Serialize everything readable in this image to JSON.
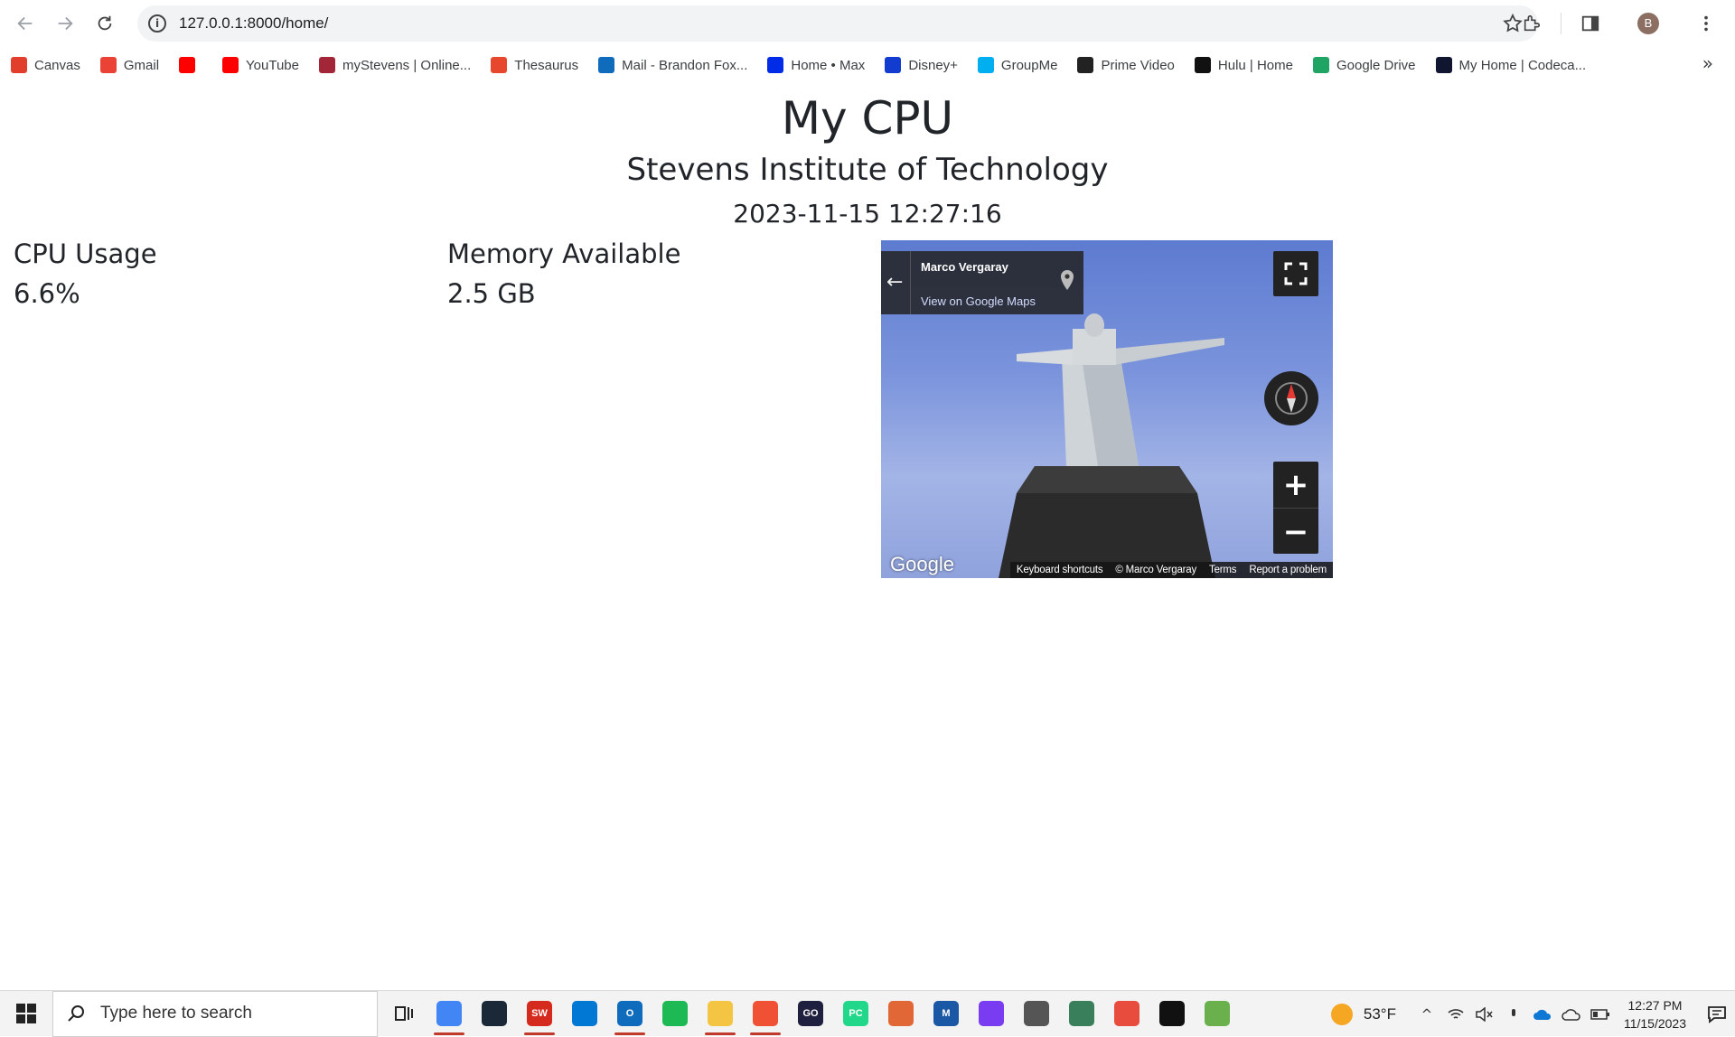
{
  "browser": {
    "url": "127.0.0.1:8000/home/",
    "profile_initial": "B",
    "bookmarks": [
      {
        "label": "Canvas",
        "icon": "canvas-icon",
        "color": "#e13f2b"
      },
      {
        "label": "Gmail",
        "icon": "gmail-icon",
        "color": "#ea4335"
      },
      {
        "label": "",
        "icon": "youtube-icon",
        "color": "#ff0000"
      },
      {
        "label": "YouTube",
        "icon": "youtube-icon",
        "color": "#ff0000"
      },
      {
        "label": "myStevens | Online...",
        "icon": "stevens-icon",
        "color": "#a32638"
      },
      {
        "label": "Thesaurus",
        "icon": "thesaurus-icon",
        "color": "#e7472c"
      },
      {
        "label": "Mail - Brandon Fox...",
        "icon": "outlook-icon",
        "color": "#0f6cbd"
      },
      {
        "label": "Home • Max",
        "icon": "max-icon",
        "color": "#002be7"
      },
      {
        "label": "Disney+",
        "icon": "disney-icon",
        "color": "#113ccf"
      },
      {
        "label": "GroupMe",
        "icon": "groupme-icon",
        "color": "#00aff0"
      },
      {
        "label": "Prime Video",
        "icon": "amazon-icon",
        "color": "#222222"
      },
      {
        "label": "Hulu | Home",
        "icon": "hulu-icon",
        "color": "#111111"
      },
      {
        "label": "Google Drive",
        "icon": "drive-icon",
        "color": "#1fa463"
      },
      {
        "label": "My Home | Codeca...",
        "icon": "codecademy-icon",
        "color": "#10162f"
      }
    ]
  },
  "page": {
    "title": "My CPU",
    "subtitle": "Stevens Institute of Technology",
    "datetime": "2023-11-15 12:27:16",
    "cpu": {
      "label": "CPU Usage",
      "value": "6.6%"
    },
    "memory": {
      "label": "Memory Available",
      "value": "2.5 GB"
    }
  },
  "streetview": {
    "author": "Marco Vergaray",
    "link": "View on Google Maps",
    "logo": "Google",
    "footer": [
      "Keyboard shortcuts",
      "© Marco Vergaray",
      "Terms",
      "Report a problem"
    ]
  },
  "taskbar": {
    "search_placeholder": "Type here to search",
    "apps": [
      {
        "name": "chrome",
        "label": "",
        "color": "#4285f4",
        "active": true
      },
      {
        "name": "steam",
        "label": "",
        "color": "#1b2838",
        "active": false
      },
      {
        "name": "solidworks",
        "label": "SW",
        "color": "#d52b1e",
        "active": true
      },
      {
        "name": "vscode",
        "label": "",
        "color": "#0078d4",
        "active": false
      },
      {
        "name": "outlook",
        "label": "O",
        "color": "#0f6cbd",
        "active": true
      },
      {
        "name": "spotify",
        "label": "",
        "color": "#1db954",
        "active": false
      },
      {
        "name": "file-explorer",
        "label": "",
        "color": "#f4c542",
        "active": true
      },
      {
        "name": "git",
        "label": "",
        "color": "#f05033",
        "active": true
      },
      {
        "name": "goland",
        "label": "GO",
        "color": "#1f1f3f",
        "active": false
      },
      {
        "name": "pycharm",
        "label": "PC",
        "color": "#21d789",
        "active": false
      },
      {
        "name": "matlab",
        "label": "",
        "color": "#e16737",
        "active": false
      },
      {
        "name": "mathcad",
        "label": "M",
        "color": "#1a57a5",
        "active": false
      },
      {
        "name": "messenger",
        "label": "",
        "color": "#7a3cf0",
        "active": false
      },
      {
        "name": "settings",
        "label": "",
        "color": "#555555",
        "active": false
      },
      {
        "name": "window-app",
        "label": "",
        "color": "#3a7f5b",
        "active": false
      },
      {
        "name": "notepad",
        "label": "",
        "color": "#e74c3c",
        "active": false
      },
      {
        "name": "terminal",
        "label": "",
        "color": "#111111",
        "active": false
      },
      {
        "name": "paint",
        "label": "",
        "color": "#6ab04c",
        "active": false
      }
    ],
    "weather": "53°F",
    "time": "12:27 PM",
    "date": "11/15/2023"
  }
}
